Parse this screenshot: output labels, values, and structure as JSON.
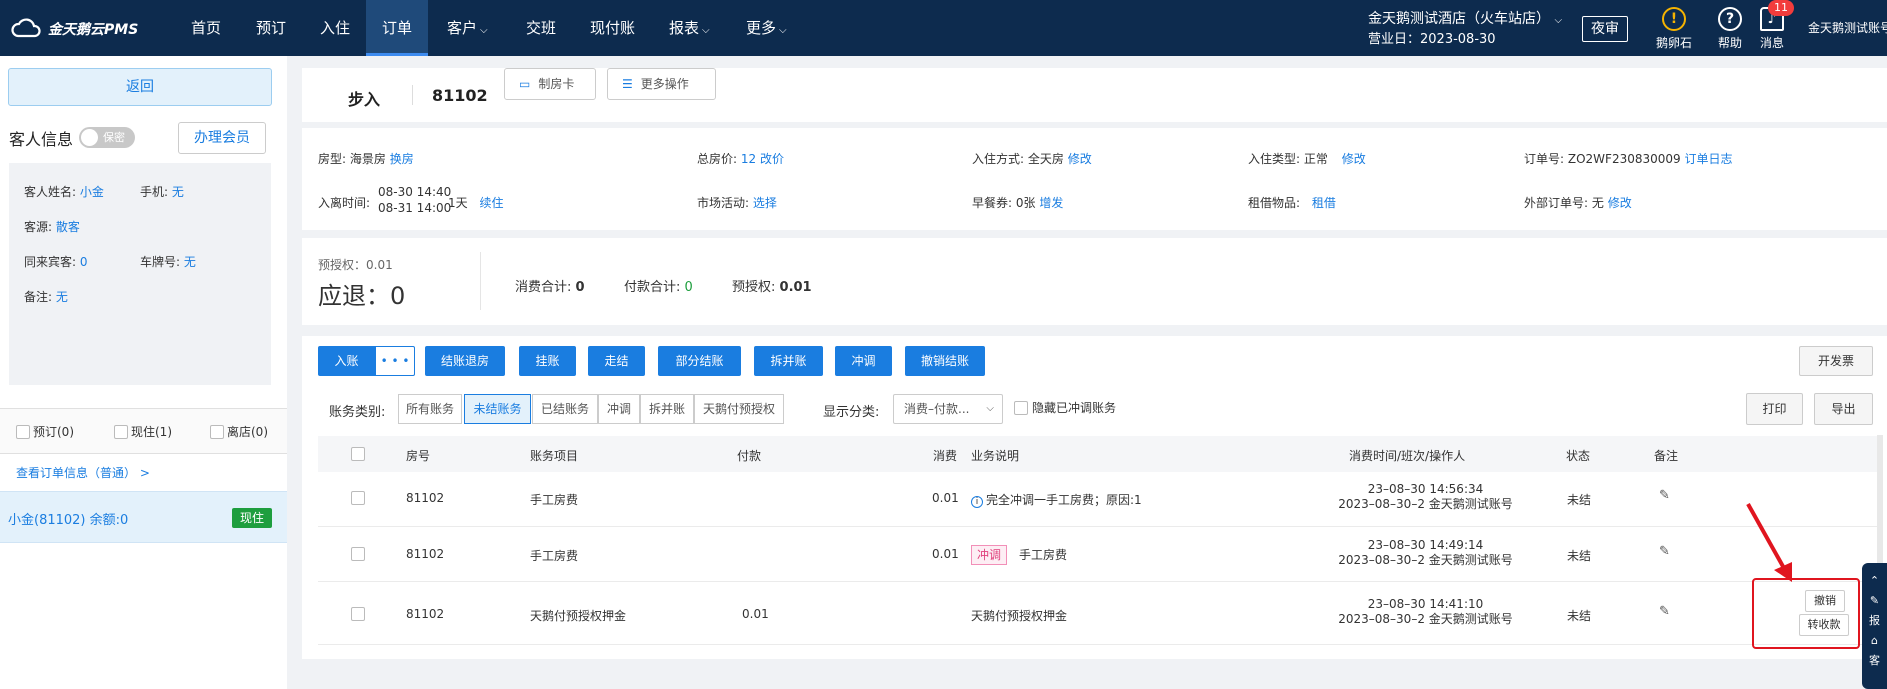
{
  "nav": {
    "logo": "金天鹅云PMS",
    "items": [
      "首页",
      "预订",
      "入住",
      "订单",
      "客户",
      "交班",
      "现付账",
      "报表",
      "更多"
    ],
    "hotel_name": "金天鹅测试酒店（火车站店）",
    "business_date": "营业日：2023-08-30",
    "night_audit": "夜审",
    "egg": "鹅卵石",
    "help": "帮助",
    "messages": "消息",
    "message_count": "11",
    "user": "金天鹅测试账号"
  },
  "left": {
    "back": "返回",
    "guest_info_title": "客人信息",
    "privacy_toggle": "保密",
    "member_btn": "办理会员",
    "guest_name_label": "客人姓名:",
    "guest_name": "小金",
    "phone_label": "手机:",
    "phone": "无",
    "source_label": "客源:",
    "source": "散客",
    "companions_label": "同来宾客:",
    "companions": "0",
    "plate_label": "车牌号:",
    "plate": "无",
    "remark_label": "备注:",
    "remark": "无",
    "filter_booked": "预订(0)",
    "filter_current": "现住(1)",
    "filter_left": "离店(0)",
    "view_order": "查看订单信息（普通） >",
    "selected_room": "小金(81102)  余额:0",
    "selected_status": "现住"
  },
  "header": {
    "status": "步入",
    "room": "81102",
    "make_card": "制房卡",
    "more_ops": "更多操作"
  },
  "info": {
    "room_type_label": "房型:",
    "room_type": "海景房",
    "change_room": "换房",
    "total_price_label": "总房价:",
    "total_price": "12",
    "change_price": "改价",
    "checkin_method_label": "入住方式:",
    "checkin_method": "全天房",
    "modify": "修改",
    "checkin_type_label": "入住类型:",
    "checkin_type": "正常",
    "order_no_label": "订单号:",
    "order_no": "ZO2WF230830009",
    "order_log": "订单日志",
    "stay_label": "入离时间:",
    "stay_in": "08-30 14:40",
    "stay_out": "08-31 14:00",
    "nights": "1天",
    "extend": "续住",
    "promo_label": "市场活动:",
    "promo_select": "选择",
    "breakfast_label": "早餐券:",
    "breakfast": "0张",
    "breakfast_add": "增发",
    "rental_label": "租借物品:",
    "rental": "租借",
    "external_label": "外部订单号:",
    "external": "无"
  },
  "totals": {
    "preauth_small": "预授权：0.01",
    "refund_label": "应退：",
    "refund": "0",
    "consume_label": "消费合计:",
    "consume": "0",
    "pay_label": "付款合计:",
    "pay": "0",
    "preauth_label": "预授权:",
    "preauth": "0.01"
  },
  "actions": {
    "post": "入账",
    "more": "• • •",
    "checkout": "结账退房",
    "hang": "挂账",
    "walk": "走结",
    "partial": "部分结账",
    "split": "拆并账",
    "adjust": "冲调",
    "undo_checkout": "撤销结账",
    "invoice": "开发票",
    "category_label": "账务类别:",
    "seg_all": "所有账务",
    "seg_open": "未结账务",
    "seg_closed": "已结账务",
    "seg_adjust": "冲调",
    "seg_split": "拆并账",
    "seg_preauth": "天鹅付预授权",
    "display_label": "显示分类:",
    "display_value": "消费–付款...",
    "hide_adjusted": "隐藏已冲调账务",
    "print": "打印",
    "export": "导出"
  },
  "table": {
    "headers": [
      "房号",
      "账务项目",
      "付款",
      "消费",
      "业务说明",
      "消费时间/班次/操作人",
      "状态",
      "备注"
    ],
    "rows": [
      {
        "room": "81102",
        "item": "手工房费",
        "pay": "",
        "consume": "0.01",
        "desc": "完全冲调一手工房费；原因:1",
        "tag": "",
        "time": "23–08–30 14:56:34",
        "shift": "2023–08–30–2 金天鹅测试账号",
        "status": "未结"
      },
      {
        "room": "81102",
        "item": "手工房费",
        "pay": "",
        "consume": "0.01",
        "desc": "手工房费",
        "tag": "冲调",
        "time": "23–08–30 14:49:14",
        "shift": "2023–08–30–2 金天鹅测试账号",
        "status": "未结"
      },
      {
        "room": "81102",
        "item": "天鹅付预授权押金",
        "pay": "0.01",
        "consume": "",
        "desc": "天鹅付预授权押金",
        "tag": "",
        "time": "23–08–30 14:41:10",
        "shift": "2023–08–30–2 金天鹅测试账号",
        "status": "未结"
      }
    ],
    "row_cancel": "撤销",
    "row_transfer": "转收款"
  },
  "side": {
    "tab1": "报",
    "tab2": "客"
  },
  "colors": {
    "nav_bg": "#0d2b4e",
    "primary": "#1a7de0",
    "refund_red": "#f23c3c",
    "highlight_box": "#e0151f"
  }
}
